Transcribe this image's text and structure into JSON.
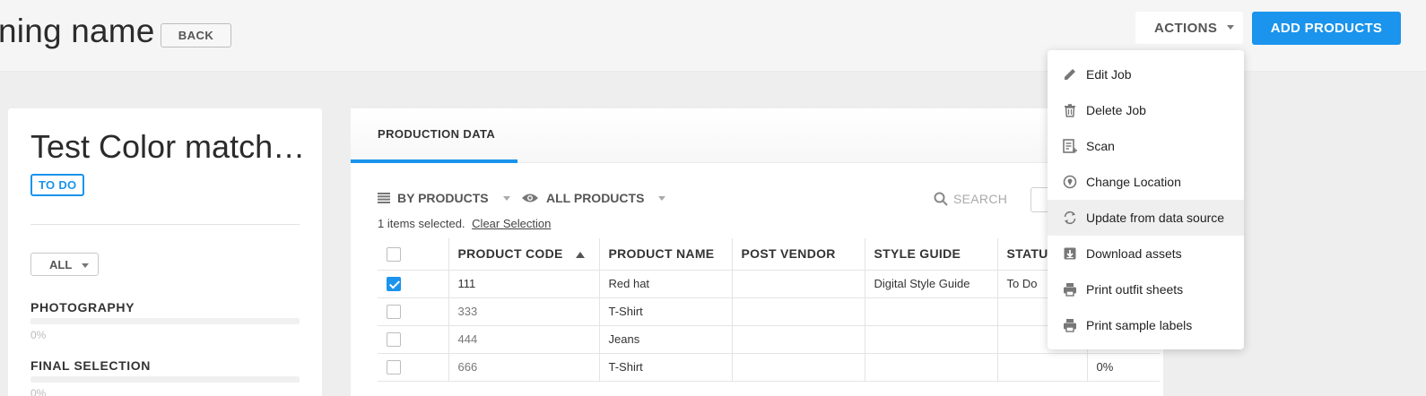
{
  "header": {
    "title": "ning name",
    "back_label": "BACK",
    "actions_label": "ACTIONS",
    "add_products_label": "ADD PRODUCTS"
  },
  "job": {
    "title": "Test Color matchi…",
    "status": "TO DO",
    "filter_value": "ALL",
    "progress": [
      {
        "label": "PHOTOGRAPHY",
        "value": "0%",
        "fraction": 0
      },
      {
        "label": "FINAL SELECTION",
        "value": "0%",
        "fraction": 0
      }
    ]
  },
  "main": {
    "tab_label": "PRODUCTION DATA",
    "group_by_label": "BY PRODUCTS",
    "view_filter_label": "ALL PRODUCTS",
    "search_placeholder": "SEARCH",
    "selection_text": "1 items selected.",
    "clear_selection_label": "Clear Selection",
    "columns": [
      "PRODUCT CODE",
      "PRODUCT NAME",
      "POST VENDOR",
      "STYLE GUIDE",
      "STATU"
    ],
    "rows": [
      {
        "checked": true,
        "code": "111",
        "name": "Red hat",
        "vendor": "",
        "style_guide": "Digital Style Guide",
        "status": "To Do",
        "extra": ""
      },
      {
        "checked": false,
        "code": "333",
        "name": "T-Shirt",
        "vendor": "",
        "style_guide": "",
        "status": "",
        "extra": ""
      },
      {
        "checked": false,
        "code": "444",
        "name": "Jeans",
        "vendor": "",
        "style_guide": "",
        "status": "",
        "extra": ""
      },
      {
        "checked": false,
        "code": "666",
        "name": "T-Shirt",
        "vendor": "",
        "style_guide": "",
        "status": "",
        "extra": "0%"
      }
    ]
  },
  "actions_menu": {
    "items": [
      {
        "label": "Edit Job",
        "icon": "pencil-icon"
      },
      {
        "label": "Delete Job",
        "icon": "trash-icon"
      },
      {
        "label": "Scan",
        "icon": "scan-icon"
      },
      {
        "label": "Change Location",
        "icon": "location-icon"
      },
      {
        "label": "Update from data source",
        "icon": "refresh-icon"
      },
      {
        "label": "Download assets",
        "icon": "download-icon"
      },
      {
        "label": "Print outfit sheets",
        "icon": "printer-icon"
      },
      {
        "label": "Print sample labels",
        "icon": "printer-icon"
      }
    ],
    "hovered_index": 4
  },
  "colors": {
    "accent": "#1a94ec"
  }
}
